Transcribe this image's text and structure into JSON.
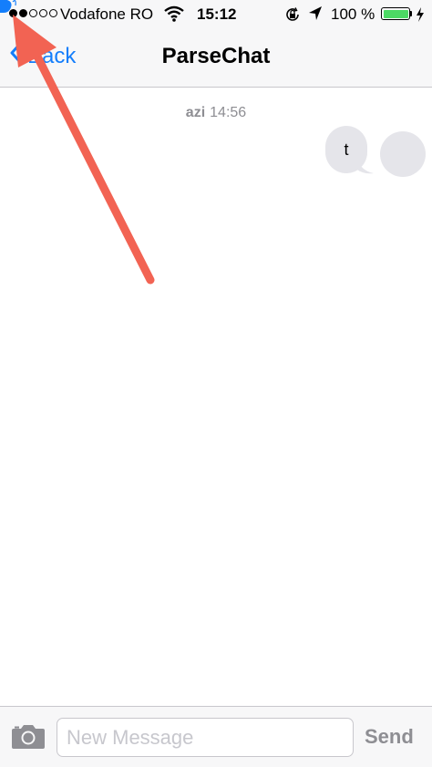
{
  "status_bar": {
    "carrier": "Vodafone RO",
    "time": "15:12",
    "battery": "100 %",
    "battery_level": 1.0,
    "signal_bars_filled": 2,
    "signal_bars_total": 5,
    "icons": [
      "wifi-icon",
      "rotation-lock-icon",
      "location-arrow-icon",
      "battery-icon",
      "charging-bolt-icon"
    ]
  },
  "nav": {
    "back_label": "Back",
    "title": "ParseChat"
  },
  "messages": [
    {
      "sender": "azi",
      "time": "14:56",
      "text": "t"
    }
  ],
  "input": {
    "placeholder": "New Message",
    "value": "",
    "send_label": "Send"
  },
  "colors": {
    "tint": "#147efb",
    "bar_background": "#f7f7f8",
    "bubble": "#e5e5ea",
    "annotation_arrow": "#f26353",
    "battery_fill": "#4cd964"
  }
}
